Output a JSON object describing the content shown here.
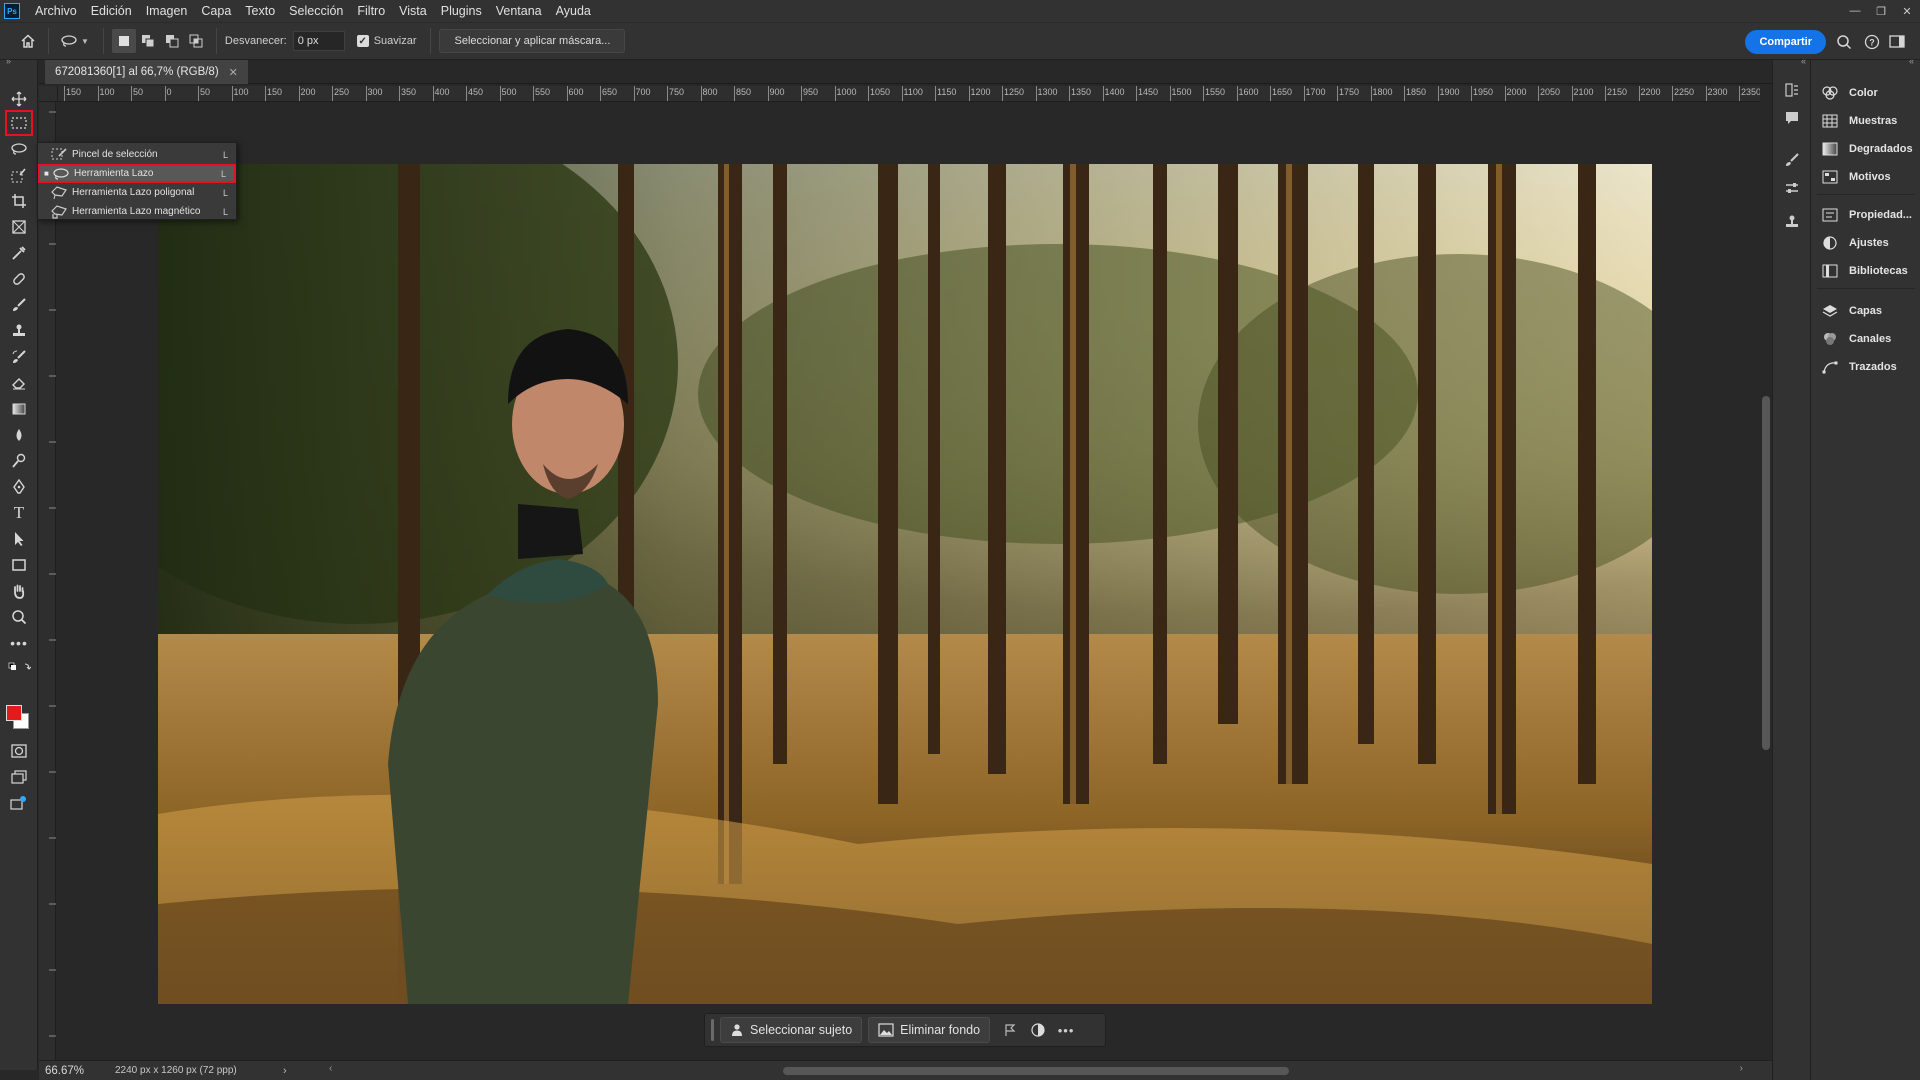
{
  "app": {
    "logo": "Ps"
  },
  "menu": [
    "Archivo",
    "Edición",
    "Imagen",
    "Capa",
    "Texto",
    "Selección",
    "Filtro",
    "Vista",
    "Plugins",
    "Ventana",
    "Ayuda"
  ],
  "options": {
    "feather_label": "Desvanecer:",
    "feather_value": "0 px",
    "antialias_label": "Suavizar",
    "antialias_checked": true,
    "select_mask_label": "Seleccionar y aplicar máscara...",
    "share_label": "Compartir"
  },
  "document": {
    "tab_title": "672081360[1] al 66,7% (RGB/8)",
    "zoom": "66.67%",
    "size": "2240 px x 1260 px (72 ppp)"
  },
  "ruler_labels": [
    "150",
    "100",
    "50",
    "0",
    "50",
    "100",
    "150",
    "200",
    "250",
    "300",
    "350",
    "400",
    "450",
    "500",
    "550",
    "600",
    "650",
    "700",
    "750",
    "800",
    "850",
    "900",
    "950",
    "1000",
    "1050",
    "1100",
    "1150",
    "1200",
    "1250",
    "1300",
    "1350",
    "1400",
    "1450",
    "1500",
    "1550",
    "1600",
    "1650",
    "1700",
    "1750",
    "1800",
    "1850",
    "1900",
    "1950",
    "2000",
    "2050",
    "2100",
    "2150",
    "2200",
    "2250",
    "2300",
    "2350"
  ],
  "flyout": {
    "items": [
      {
        "label": "Pincel de selección",
        "shortcut": "L",
        "icon": "selection-brush-icon",
        "active": false
      },
      {
        "label": "Herramienta Lazo",
        "shortcut": "L",
        "icon": "lasso-icon",
        "active": true
      },
      {
        "label": "Herramienta Lazo poligonal",
        "shortcut": "L",
        "icon": "polygonal-lasso-icon",
        "active": false
      },
      {
        "label": "Herramienta Lazo magnético",
        "shortcut": "L",
        "icon": "magnetic-lasso-icon",
        "active": false
      }
    ]
  },
  "taskbar": {
    "select_subject": "Seleccionar sujeto",
    "remove_background": "Eliminar fondo"
  },
  "panels": [
    {
      "label": "Color",
      "icon": "color-palette-icon"
    },
    {
      "label": "Muestras",
      "icon": "swatches-grid-icon"
    },
    {
      "label": "Degradados",
      "icon": "gradient-icon"
    },
    {
      "label": "Motivos",
      "icon": "patterns-icon"
    },
    {
      "label": "Propiedad...",
      "icon": "properties-icon"
    },
    {
      "label": "Ajustes",
      "icon": "adjustments-icon"
    },
    {
      "label": "Bibliotecas",
      "icon": "libraries-icon"
    },
    {
      "label": "Capas",
      "icon": "layers-icon"
    },
    {
      "label": "Canales",
      "icon": "channels-icon"
    },
    {
      "label": "Trazados",
      "icon": "paths-icon"
    }
  ],
  "colors": {
    "foreground": "#e31b1b",
    "background": "#ffffff",
    "accent": "#1473e6",
    "highlight": "#e81123"
  }
}
